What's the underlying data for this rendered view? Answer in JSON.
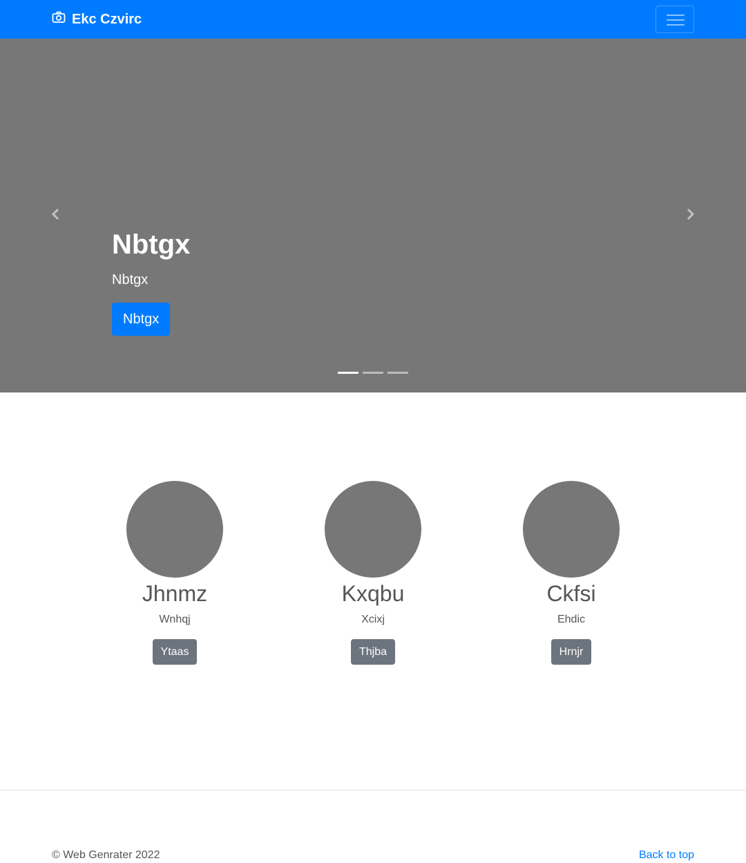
{
  "navbar": {
    "brand": "Ekc Czvirc",
    "brand_icon": "camera-icon",
    "toggler_icon": "menu-icon",
    "bg_color": "#007bff"
  },
  "carousel": {
    "title": "Nbtgx",
    "subtitle": "Nbtgx",
    "button_label": "Nbtgx",
    "prev_icon": "chevron-left-icon",
    "next_icon": "chevron-right-icon",
    "slide_count": 3,
    "active_slide": 1
  },
  "features": [
    {
      "heading": "Jhnmz",
      "text": "Wnhqj",
      "button_label": "Ytaas"
    },
    {
      "heading": "Kxqbu",
      "text": "Xcixj",
      "button_label": "Thjba"
    },
    {
      "heading": "Ckfsi",
      "text": "Ehdic",
      "button_label": "Hrnjr"
    }
  ],
  "footer": {
    "copyright": "© Web Genrater 2022",
    "back_to_top": "Back to top"
  }
}
